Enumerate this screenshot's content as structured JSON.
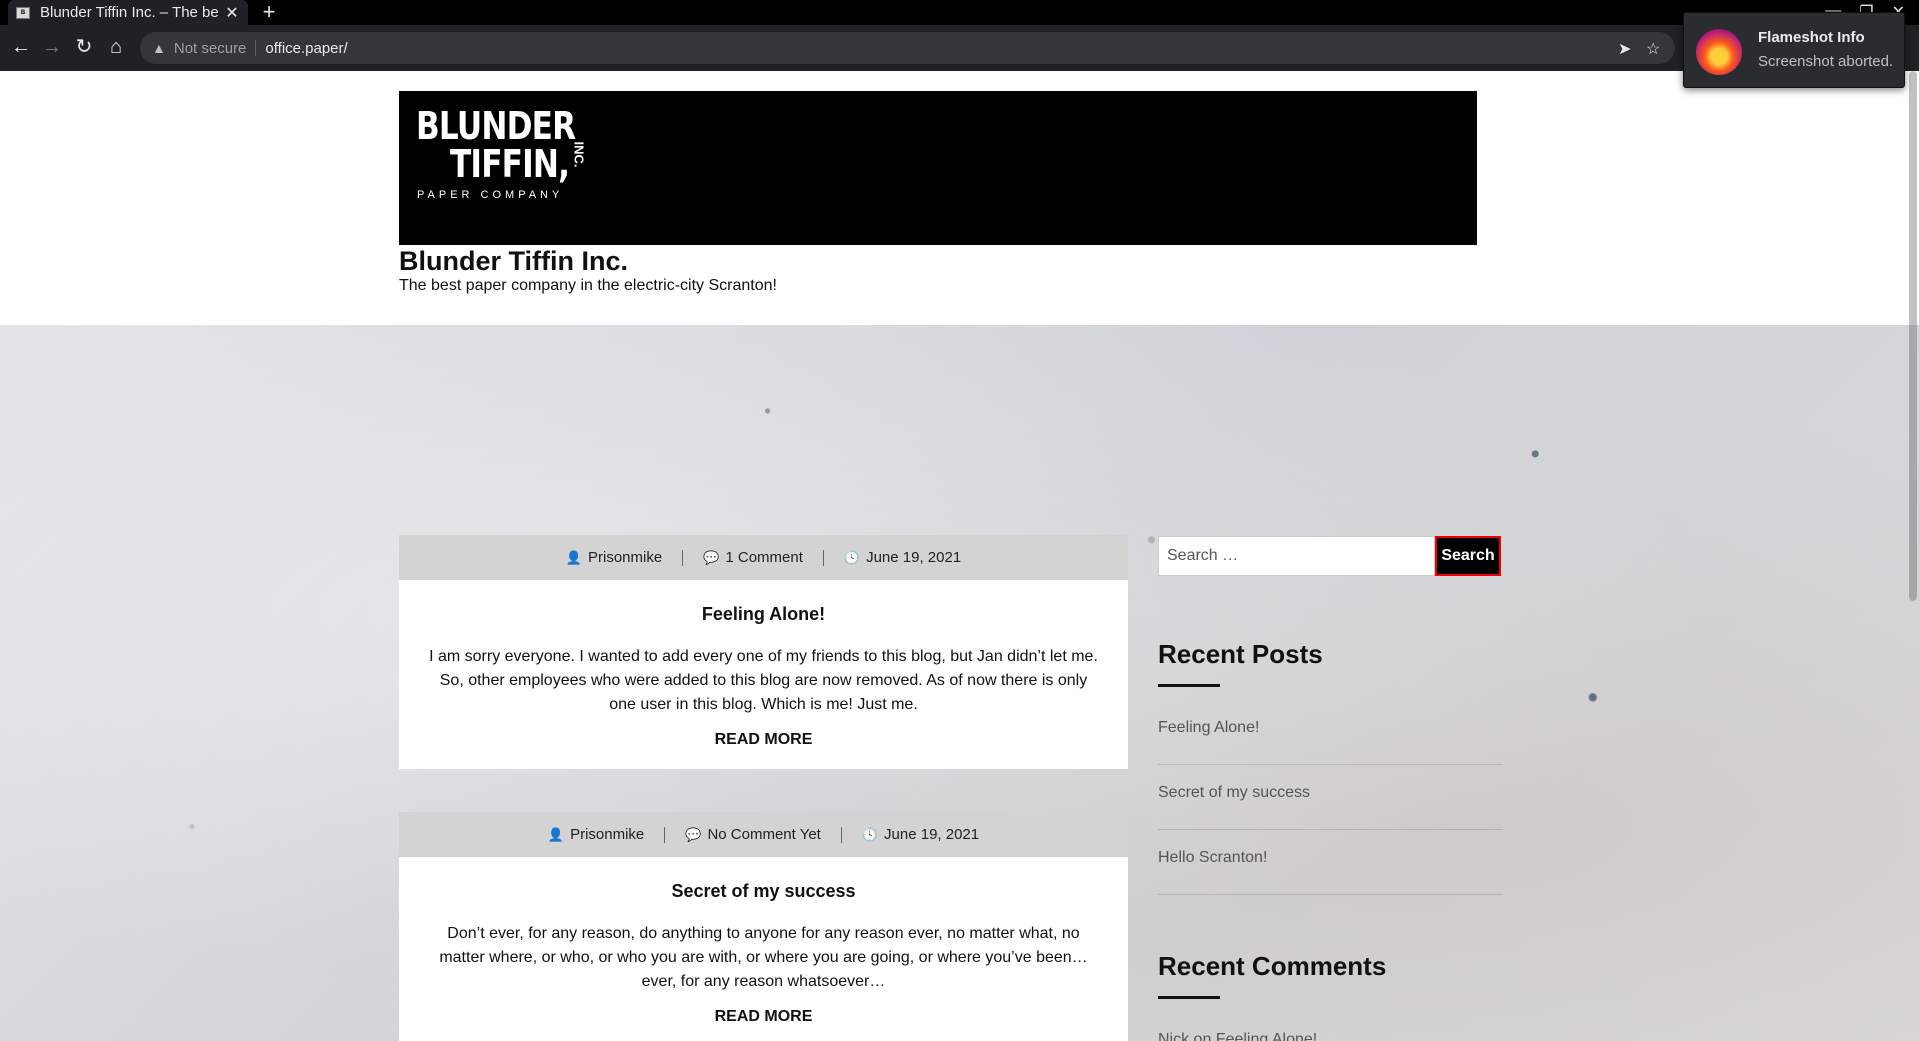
{
  "browser": {
    "tab_title": "Blunder Tiffin Inc. – The be",
    "favicon_text": "BLUNDER",
    "new_tab": "+",
    "not_secure": "Not secure",
    "url": "office.paper/",
    "window_controls": [
      "⌄",
      "—",
      "❐",
      "✕"
    ]
  },
  "notification": {
    "title": "Flameshot Info",
    "body": "Screenshot aborted."
  },
  "header": {
    "logo_line1": "BLUNDER",
    "logo_line2": "TIFFIN,",
    "logo_inc": "INC.",
    "logo_line3": "PAPER COMPANY",
    "site_title": "Blunder Tiffin Inc.",
    "site_description": "The best paper company in the electric-city Scranton!"
  },
  "posts": [
    {
      "author": "Prisonmike",
      "comments": "1 Comment",
      "date": "June 19, 2021",
      "title": "Feeling Alone!",
      "excerpt": "I am sorry everyone. I wanted to add every one of my friends to this blog, but Jan didn’t let me. So, other employees who were added to this blog are now removed. As of now there is only one user in this blog. Which is me! Just me.",
      "read_more": "READ MORE"
    },
    {
      "author": "Prisonmike",
      "comments": "No Comment Yet",
      "date": "June 19, 2021",
      "title": "Secret of my success",
      "excerpt": "Don’t ever, for any reason, do anything to anyone for any reason ever, no matter what, no matter where, or who, or who you are with, or where you are going, or where you’ve been… ever, for any reason whatsoever…",
      "read_more": "READ MORE"
    }
  ],
  "sidebar": {
    "search_placeholder": "Search …",
    "search_button": "Search",
    "recent_posts_title": "Recent Posts",
    "recent_posts": [
      "Feeling Alone!",
      "Secret of my success",
      "Hello Scranton!"
    ],
    "recent_comments_title": "Recent Comments",
    "recent_comment": "Nick on Feeling Alone!"
  },
  "icons": {
    "author": "user-icon",
    "comments": "comments-icon",
    "date": "clock-icon"
  }
}
